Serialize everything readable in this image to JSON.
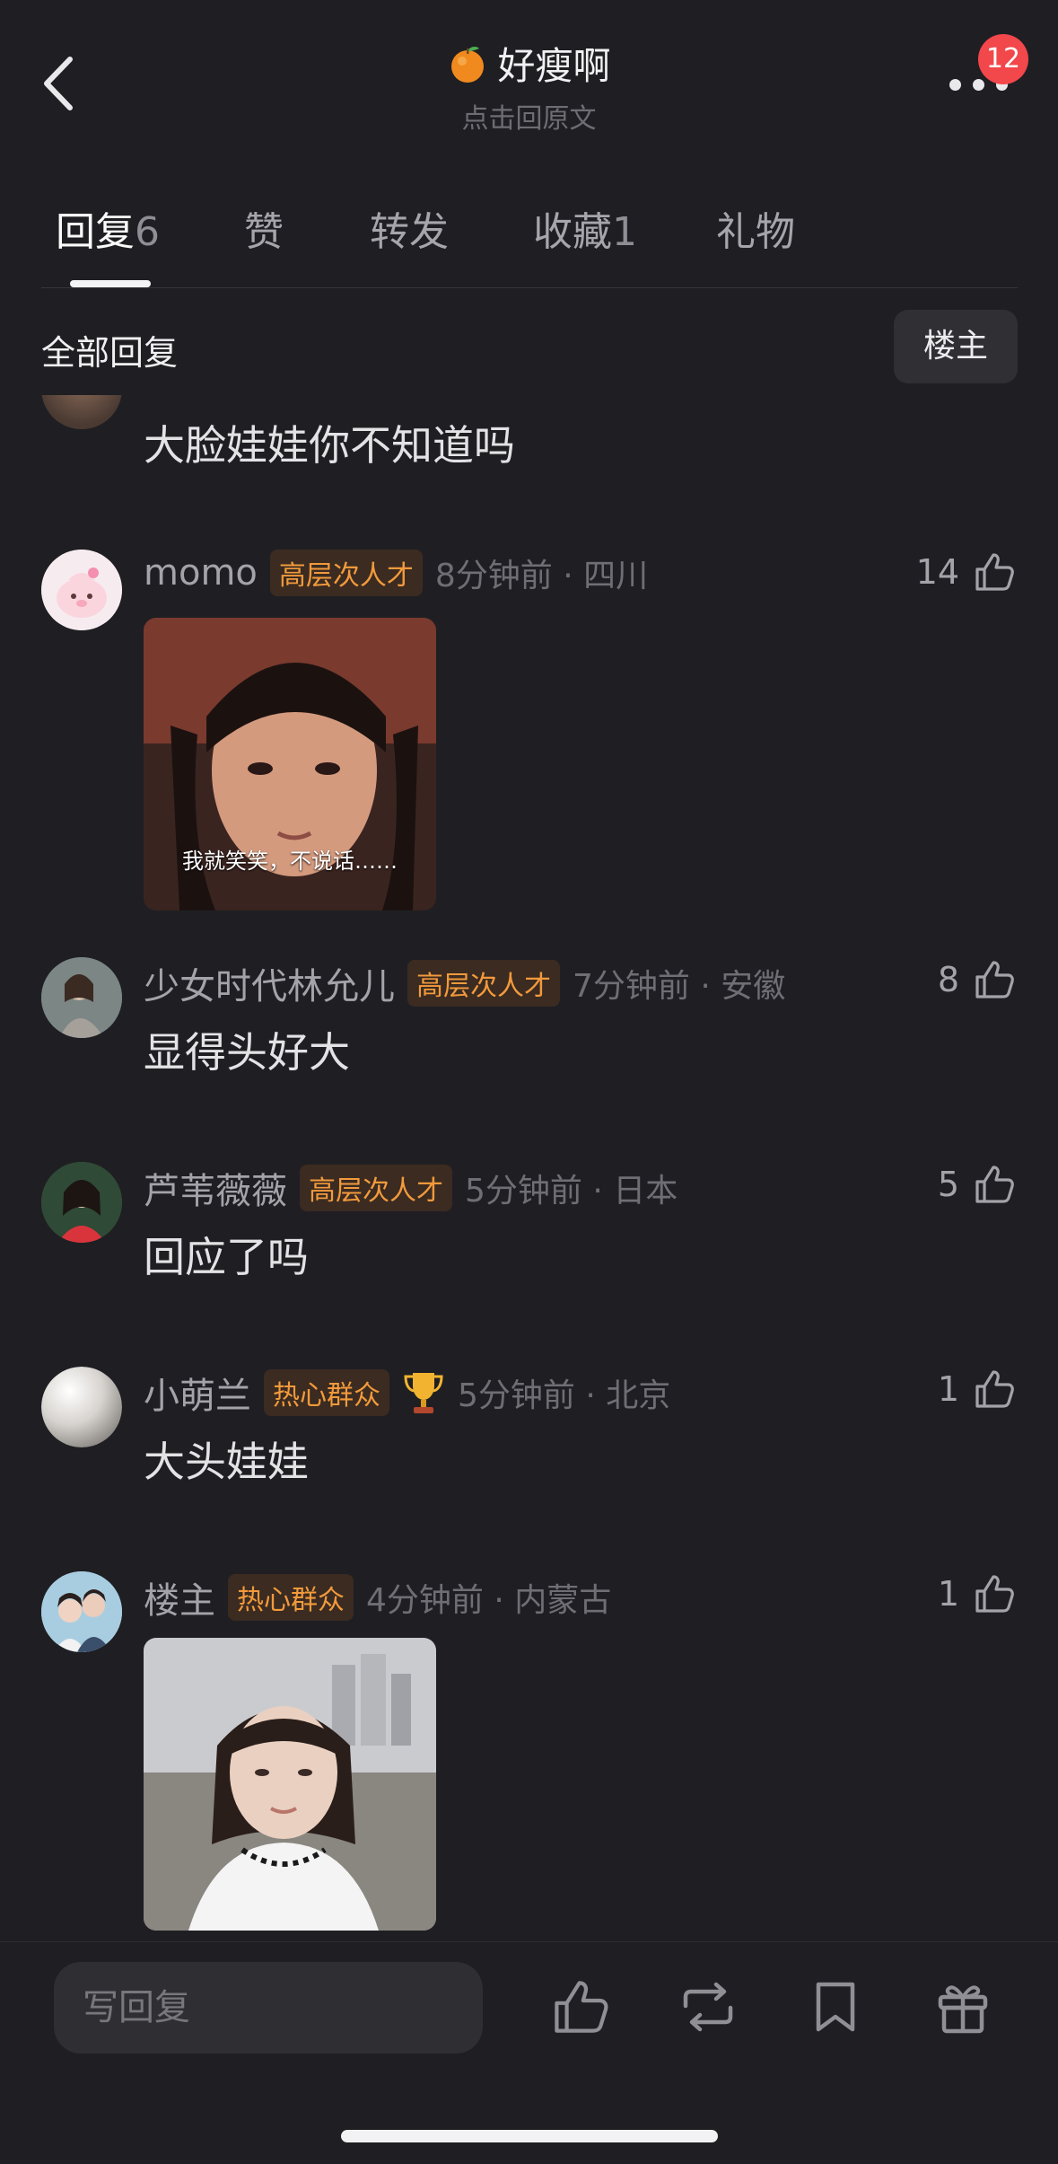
{
  "header": {
    "title": "好瘦啊",
    "subtitle": "点击回原文",
    "badge_count": "12"
  },
  "tabs": [
    {
      "label": "回复",
      "count": "6",
      "active": true
    },
    {
      "label": "赞",
      "count": "",
      "active": false
    },
    {
      "label": "转发",
      "count": "",
      "active": false
    },
    {
      "label": "收藏",
      "count": "1",
      "active": false
    },
    {
      "label": "礼物",
      "count": "",
      "active": false
    }
  ],
  "filter": {
    "label": "全部回复",
    "op_button": "楼主"
  },
  "partial_comment": {
    "text": "大脸娃娃你不知道吗"
  },
  "comments": [
    {
      "user": "momo",
      "tag": "高层次人才",
      "time": "8分钟前 · 四川",
      "likes": "14",
      "text": "",
      "image_caption": "我就笑笑，不说话……"
    },
    {
      "user": "少女时代林允儿",
      "tag": "高层次人才",
      "time": "7分钟前 · 安徽",
      "likes": "8",
      "text": "显得头好大"
    },
    {
      "user": "芦苇薇薇",
      "tag": "高层次人才",
      "time": "5分钟前 · 日本",
      "likes": "5",
      "text": "回应了吗"
    },
    {
      "user": "小萌兰",
      "tag": "热心群众",
      "time": "5分钟前 · 北京",
      "likes": "1",
      "text": "大头娃娃",
      "trophy": "trophy-icon"
    },
    {
      "user": "楼主",
      "tag": "热心群众",
      "time": "4分钟前 · 内蒙古",
      "likes": "1",
      "text": ""
    }
  ],
  "bottom_bar": {
    "reply_placeholder": "写回复",
    "icons": [
      "like-icon",
      "repost-icon",
      "bookmark-icon",
      "gift-icon"
    ]
  },
  "colors": {
    "background": "#1f1f23",
    "tag_text": "#f29a3c",
    "badge": "#f2474b"
  }
}
